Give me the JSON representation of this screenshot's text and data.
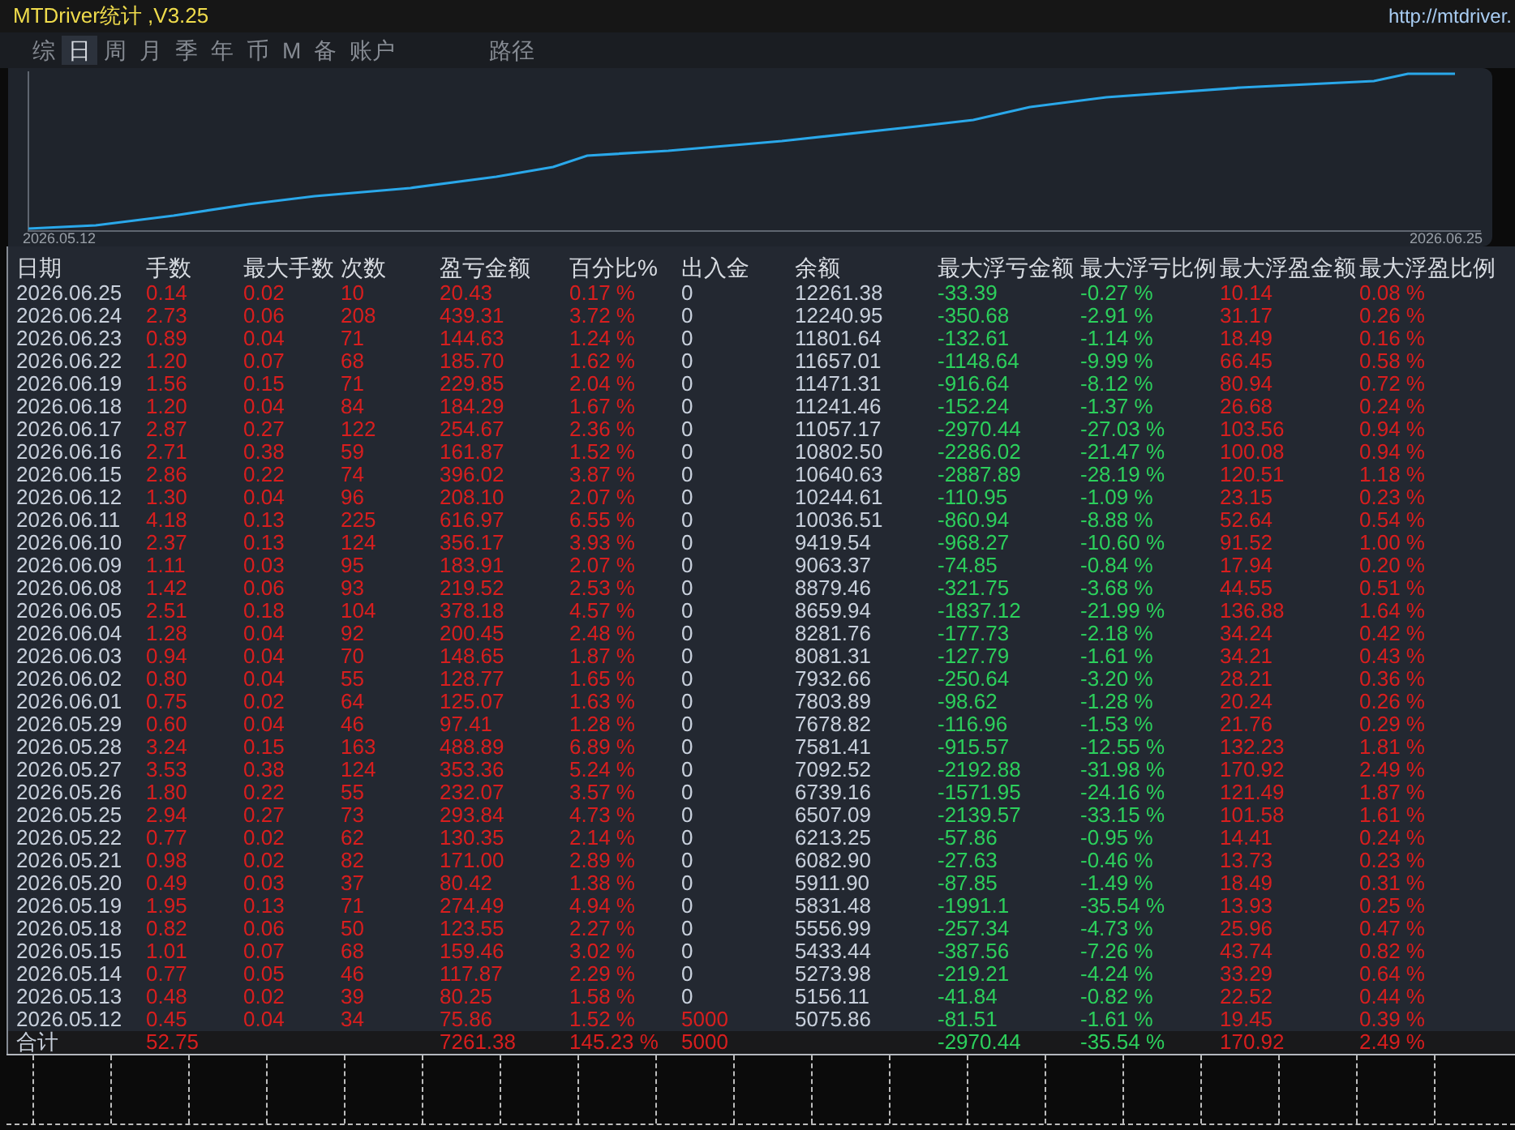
{
  "window": {
    "title": "MTDriver统计 ,V3.25",
    "url": "http://mtdriver."
  },
  "tabs": [
    {
      "label": "综",
      "selected": false
    },
    {
      "label": "日",
      "selected": true
    },
    {
      "label": "周",
      "selected": false
    },
    {
      "label": "月",
      "selected": false
    },
    {
      "label": "季",
      "selected": false
    },
    {
      "label": "年",
      "selected": false
    },
    {
      "label": "币",
      "selected": false
    },
    {
      "label": "M",
      "selected": false
    },
    {
      "label": "备",
      "selected": false
    },
    {
      "label": "账户",
      "selected": false
    }
  ],
  "path_button": {
    "label": "路径"
  },
  "chart": {
    "start_label": "2026.05.12",
    "end_label": "2026.06.25"
  },
  "table": {
    "columns": [
      {
        "label": "日期",
        "kind": "plain"
      },
      {
        "label": "手数",
        "kind": "gain"
      },
      {
        "label": "最大手数",
        "kind": "gain"
      },
      {
        "label": "次数",
        "kind": "gain"
      },
      {
        "label": "盈亏金额",
        "kind": "gain"
      },
      {
        "label": "百分比%",
        "kind": "gain"
      },
      {
        "label": "出入金",
        "kind": "plain"
      },
      {
        "label": "余额",
        "kind": "plain"
      },
      {
        "label": "最大浮亏金额",
        "kind": "loss"
      },
      {
        "label": "最大浮亏比例",
        "kind": "loss"
      },
      {
        "label": "最大浮盈金额",
        "kind": "gain"
      },
      {
        "label": "最大浮盈比例",
        "kind": "gain"
      }
    ],
    "rows": [
      {
        "cells": [
          "2026.06.25",
          "0.14",
          "0.02",
          "10",
          "20.43",
          "0.17 %",
          "0",
          "12261.38",
          "-33.39",
          "-0.27 %",
          "10.14",
          "0.08 %"
        ],
        "deposit_highlighted": false
      },
      {
        "cells": [
          "2026.06.24",
          "2.73",
          "0.06",
          "208",
          "439.31",
          "3.72 %",
          "0",
          "12240.95",
          "-350.68",
          "-2.91 %",
          "31.17",
          "0.26 %"
        ],
        "deposit_highlighted": false
      },
      {
        "cells": [
          "2026.06.23",
          "0.89",
          "0.04",
          "71",
          "144.63",
          "1.24 %",
          "0",
          "11801.64",
          "-132.61",
          "-1.14 %",
          "18.49",
          "0.16 %"
        ],
        "deposit_highlighted": false
      },
      {
        "cells": [
          "2026.06.22",
          "1.20",
          "0.07",
          "68",
          "185.70",
          "1.62 %",
          "0",
          "11657.01",
          "-1148.64",
          "-9.99 %",
          "66.45",
          "0.58 %"
        ],
        "deposit_highlighted": false
      },
      {
        "cells": [
          "2026.06.19",
          "1.56",
          "0.15",
          "71",
          "229.85",
          "2.04 %",
          "0",
          "11471.31",
          "-916.64",
          "-8.12 %",
          "80.94",
          "0.72 %"
        ],
        "deposit_highlighted": false
      },
      {
        "cells": [
          "2026.06.18",
          "1.20",
          "0.04",
          "84",
          "184.29",
          "1.67 %",
          "0",
          "11241.46",
          "-152.24",
          "-1.37 %",
          "26.68",
          "0.24 %"
        ],
        "deposit_highlighted": false
      },
      {
        "cells": [
          "2026.06.17",
          "2.87",
          "0.27",
          "122",
          "254.67",
          "2.36 %",
          "0",
          "11057.17",
          "-2970.44",
          "-27.03 %",
          "103.56",
          "0.94 %"
        ],
        "deposit_highlighted": false
      },
      {
        "cells": [
          "2026.06.16",
          "2.71",
          "0.38",
          "59",
          "161.87",
          "1.52 %",
          "0",
          "10802.50",
          "-2286.02",
          "-21.47 %",
          "100.08",
          "0.94 %"
        ],
        "deposit_highlighted": false
      },
      {
        "cells": [
          "2026.06.15",
          "2.86",
          "0.22",
          "74",
          "396.02",
          "3.87 %",
          "0",
          "10640.63",
          "-2887.89",
          "-28.19 %",
          "120.51",
          "1.18 %"
        ],
        "deposit_highlighted": false
      },
      {
        "cells": [
          "2026.06.12",
          "1.30",
          "0.04",
          "96",
          "208.10",
          "2.07 %",
          "0",
          "10244.61",
          "-110.95",
          "-1.09 %",
          "23.15",
          "0.23 %"
        ],
        "deposit_highlighted": false
      },
      {
        "cells": [
          "2026.06.11",
          "4.18",
          "0.13",
          "225",
          "616.97",
          "6.55 %",
          "0",
          "10036.51",
          "-860.94",
          "-8.88 %",
          "52.64",
          "0.54 %"
        ],
        "deposit_highlighted": false
      },
      {
        "cells": [
          "2026.06.10",
          "2.37",
          "0.13",
          "124",
          "356.17",
          "3.93 %",
          "0",
          "9419.54",
          "-968.27",
          "-10.60 %",
          "91.52",
          "1.00 %"
        ],
        "deposit_highlighted": false
      },
      {
        "cells": [
          "2026.06.09",
          "1.11",
          "0.03",
          "95",
          "183.91",
          "2.07 %",
          "0",
          "9063.37",
          "-74.85",
          "-0.84 %",
          "17.94",
          "0.20 %"
        ],
        "deposit_highlighted": false
      },
      {
        "cells": [
          "2026.06.08",
          "1.42",
          "0.06",
          "93",
          "219.52",
          "2.53 %",
          "0",
          "8879.46",
          "-321.75",
          "-3.68 %",
          "44.55",
          "0.51 %"
        ],
        "deposit_highlighted": false
      },
      {
        "cells": [
          "2026.06.05",
          "2.51",
          "0.18",
          "104",
          "378.18",
          "4.57 %",
          "0",
          "8659.94",
          "-1837.12",
          "-21.99 %",
          "136.88",
          "1.64 %"
        ],
        "deposit_highlighted": false
      },
      {
        "cells": [
          "2026.06.04",
          "1.28",
          "0.04",
          "92",
          "200.45",
          "2.48 %",
          "0",
          "8281.76",
          "-177.73",
          "-2.18 %",
          "34.24",
          "0.42 %"
        ],
        "deposit_highlighted": false
      },
      {
        "cells": [
          "2026.06.03",
          "0.94",
          "0.04",
          "70",
          "148.65",
          "1.87 %",
          "0",
          "8081.31",
          "-127.79",
          "-1.61 %",
          "34.21",
          "0.43 %"
        ],
        "deposit_highlighted": false
      },
      {
        "cells": [
          "2026.06.02",
          "0.80",
          "0.04",
          "55",
          "128.77",
          "1.65 %",
          "0",
          "7932.66",
          "-250.64",
          "-3.20 %",
          "28.21",
          "0.36 %"
        ],
        "deposit_highlighted": false
      },
      {
        "cells": [
          "2026.06.01",
          "0.75",
          "0.02",
          "64",
          "125.07",
          "1.63 %",
          "0",
          "7803.89",
          "-98.62",
          "-1.28 %",
          "20.24",
          "0.26 %"
        ],
        "deposit_highlighted": false
      },
      {
        "cells": [
          "2026.05.29",
          "0.60",
          "0.04",
          "46",
          "97.41",
          "1.28 %",
          "0",
          "7678.82",
          "-116.96",
          "-1.53 %",
          "21.76",
          "0.29 %"
        ],
        "deposit_highlighted": false
      },
      {
        "cells": [
          "2026.05.28",
          "3.24",
          "0.15",
          "163",
          "488.89",
          "6.89 %",
          "0",
          "7581.41",
          "-915.57",
          "-12.55 %",
          "132.23",
          "1.81 %"
        ],
        "deposit_highlighted": false
      },
      {
        "cells": [
          "2026.05.27",
          "3.53",
          "0.38",
          "124",
          "353.36",
          "5.24 %",
          "0",
          "7092.52",
          "-2192.88",
          "-31.98 %",
          "170.92",
          "2.49 %"
        ],
        "deposit_highlighted": false
      },
      {
        "cells": [
          "2026.05.26",
          "1.80",
          "0.22",
          "55",
          "232.07",
          "3.57 %",
          "0",
          "6739.16",
          "-1571.95",
          "-24.16 %",
          "121.49",
          "1.87 %"
        ],
        "deposit_highlighted": false
      },
      {
        "cells": [
          "2026.05.25",
          "2.94",
          "0.27",
          "73",
          "293.84",
          "4.73 %",
          "0",
          "6507.09",
          "-2139.57",
          "-33.15 %",
          "101.58",
          "1.61 %"
        ],
        "deposit_highlighted": false
      },
      {
        "cells": [
          "2026.05.22",
          "0.77",
          "0.02",
          "62",
          "130.35",
          "2.14 %",
          "0",
          "6213.25",
          "-57.86",
          "-0.95 %",
          "14.41",
          "0.24 %"
        ],
        "deposit_highlighted": false
      },
      {
        "cells": [
          "2026.05.21",
          "0.98",
          "0.02",
          "82",
          "171.00",
          "2.89 %",
          "0",
          "6082.90",
          "-27.63",
          "-0.46 %",
          "13.73",
          "0.23 %"
        ],
        "deposit_highlighted": false
      },
      {
        "cells": [
          "2026.05.20",
          "0.49",
          "0.03",
          "37",
          "80.42",
          "1.38 %",
          "0",
          "5911.90",
          "-87.85",
          "-1.49 %",
          "18.49",
          "0.31 %"
        ],
        "deposit_highlighted": false
      },
      {
        "cells": [
          "2026.05.19",
          "1.95",
          "0.13",
          "71",
          "274.49",
          "4.94 %",
          "0",
          "5831.48",
          "-1991.1",
          "-35.54 %",
          "13.93",
          "0.25 %"
        ],
        "deposit_highlighted": false
      },
      {
        "cells": [
          "2026.05.18",
          "0.82",
          "0.06",
          "50",
          "123.55",
          "2.27 %",
          "0",
          "5556.99",
          "-257.34",
          "-4.73 %",
          "25.96",
          "0.47 %"
        ],
        "deposit_highlighted": false
      },
      {
        "cells": [
          "2026.05.15",
          "1.01",
          "0.07",
          "68",
          "159.46",
          "3.02 %",
          "0",
          "5433.44",
          "-387.56",
          "-7.26 %",
          "43.74",
          "0.82 %"
        ],
        "deposit_highlighted": false
      },
      {
        "cells": [
          "2026.05.14",
          "0.77",
          "0.05",
          "46",
          "117.87",
          "2.29 %",
          "0",
          "5273.98",
          "-219.21",
          "-4.24 %",
          "33.29",
          "0.64 %"
        ],
        "deposit_highlighted": false
      },
      {
        "cells": [
          "2026.05.13",
          "0.48",
          "0.02",
          "39",
          "80.25",
          "1.58 %",
          "0",
          "5156.11",
          "-41.84",
          "-0.82 %",
          "22.52",
          "0.44 %"
        ],
        "deposit_highlighted": false
      },
      {
        "cells": [
          "2026.05.12",
          "0.45",
          "0.04",
          "34",
          "75.86",
          "1.52 %",
          "5000",
          "5075.86",
          "-81.51",
          "-1.61 %",
          "19.45",
          "0.39 %"
        ],
        "deposit_highlighted": true
      }
    ],
    "total": {
      "label": "合计",
      "lots": "52.75",
      "profit": "7261.38",
      "percent": "145.23 %",
      "deposit": "5000",
      "max_float_loss": "-2970.44",
      "max_float_loss_pct": "-35.54 %",
      "max_float_profit": "170.92",
      "max_float_profit_pct": "2.49 %",
      "deposit_highlighted": true
    }
  }
}
